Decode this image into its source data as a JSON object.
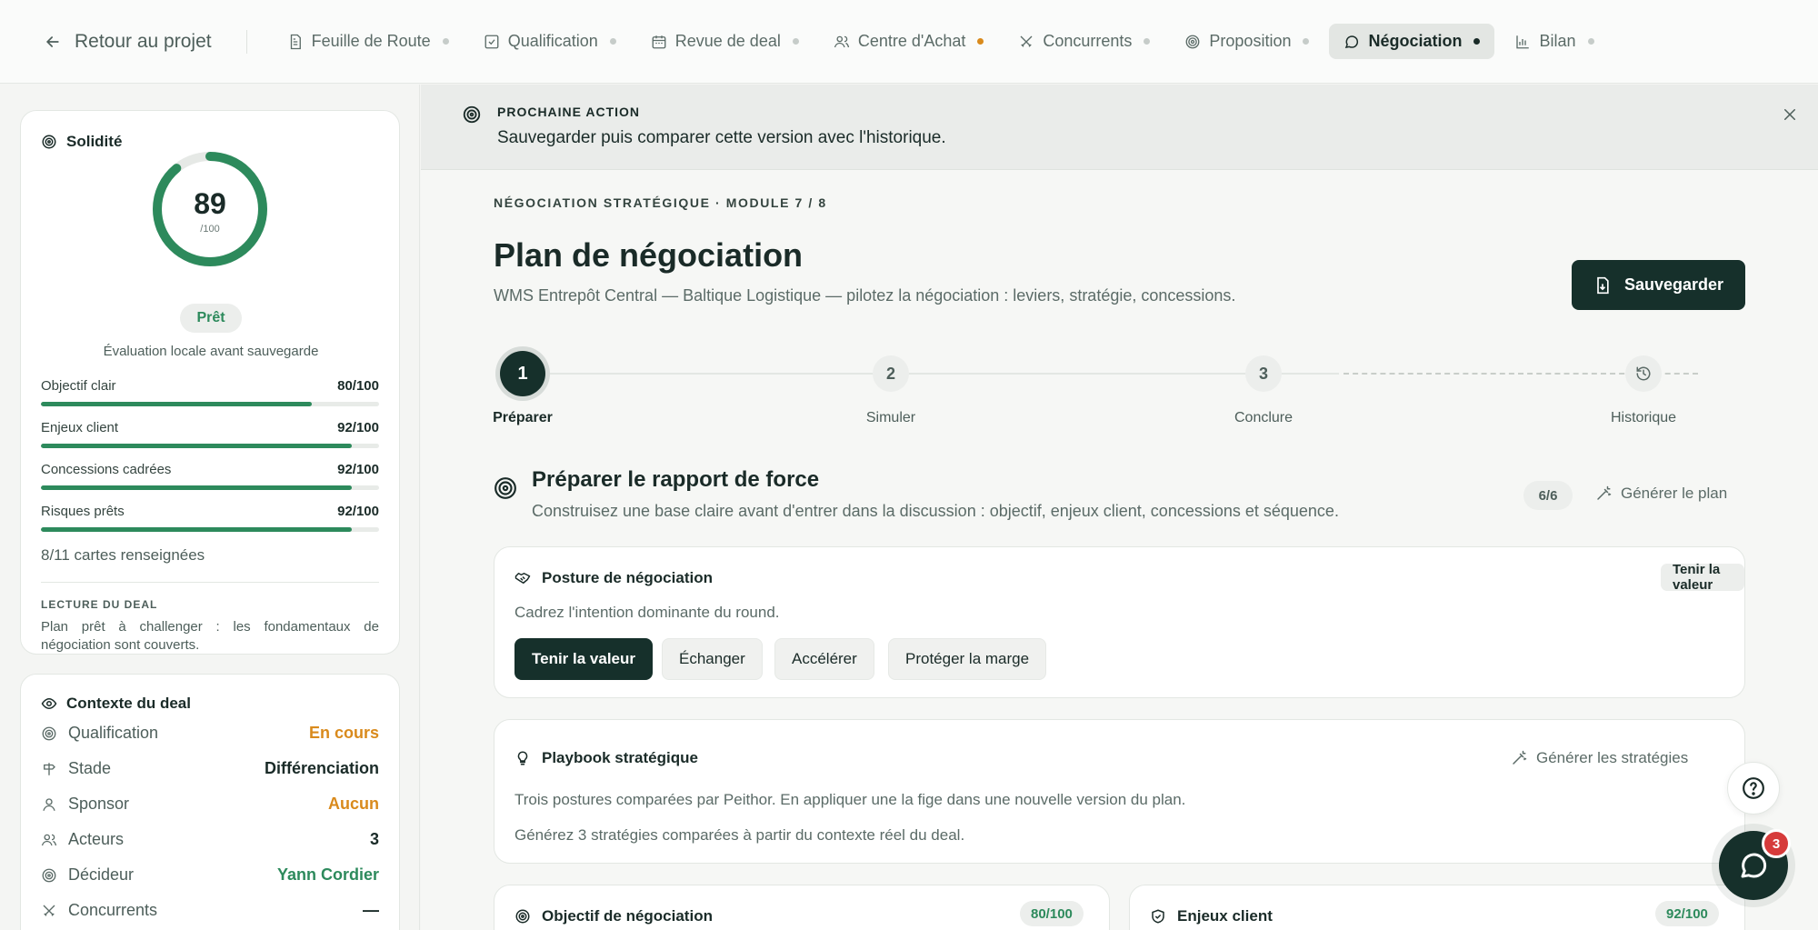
{
  "nav": {
    "back_label": "Retour au projet",
    "tabs": [
      {
        "label": "Feuille de Route",
        "icon": "file-text-icon",
        "dot": "grey"
      },
      {
        "label": "Qualification",
        "icon": "check-square-icon",
        "dot": "grey"
      },
      {
        "label": "Revue de deal",
        "icon": "calendar-icon",
        "dot": "grey"
      },
      {
        "label": "Centre d'Achat",
        "icon": "users-icon",
        "dot": "orange"
      },
      {
        "label": "Concurrents",
        "icon": "swords-icon",
        "dot": "grey"
      },
      {
        "label": "Proposition",
        "icon": "target-icon",
        "dot": "grey"
      },
      {
        "label": "Négociation",
        "icon": "chat-bubble-icon",
        "dot": "dark",
        "active": true
      },
      {
        "label": "Bilan",
        "icon": "bar-chart-icon",
        "dot": "grey"
      }
    ]
  },
  "sidebar": {
    "solidity": {
      "title": "Solidité",
      "score": 89,
      "score_max": "/100",
      "status": "Prêt",
      "note": "Évaluation locale avant sauvegarde",
      "metrics": [
        {
          "label": "Objectif clair",
          "value": "80/100",
          "pct": 80
        },
        {
          "label": "Enjeux client",
          "value": "92/100",
          "pct": 92
        },
        {
          "label": "Concessions cadrées",
          "value": "92/100",
          "pct": 92
        },
        {
          "label": "Risques prêts",
          "value": "92/100",
          "pct": 92
        }
      ],
      "cards_filled": "8/11 cartes renseignées",
      "reading_label": "LECTURE DU DEAL",
      "reading_text": "Plan prêt à challenger : les fondamentaux de négociation sont couverts."
    },
    "context": {
      "title": "Contexte du deal",
      "rows": [
        {
          "label": "Qualification",
          "value": "En cours",
          "color": "#d98a1c",
          "icon": "target-icon"
        },
        {
          "label": "Stade",
          "value": "Différenciation",
          "color": "#1a2b28",
          "icon": "signpost-icon"
        },
        {
          "label": "Sponsor",
          "value": "Aucun",
          "color": "#d98a1c",
          "icon": "user-icon"
        },
        {
          "label": "Acteurs",
          "value": "3",
          "color": "#1a2b28",
          "icon": "users-icon"
        },
        {
          "label": "Décideur",
          "value": "Yann Cordier",
          "color": "#2d8a5c",
          "icon": "target-icon"
        },
        {
          "label": "Concurrents",
          "value": "—",
          "color": "#1a2b28",
          "icon": "swords-icon"
        }
      ]
    }
  },
  "banner": {
    "label": "PROCHAINE ACTION",
    "text": "Sauvegarder puis comparer cette version avec l'historique."
  },
  "header": {
    "eyebrow": "NÉGOCIATION STRATÉGIQUE · MODULE 7 / 8",
    "title": "Plan de négociation",
    "subtitle": "WMS Entrepôt Central — Baltique Logistique — pilotez la négociation : leviers, stratégie, concessions.",
    "save_label": "Sauvegarder"
  },
  "steps": [
    {
      "num": "1",
      "label": "Préparer",
      "active": true
    },
    {
      "num": "2",
      "label": "Simuler"
    },
    {
      "num": "3",
      "label": "Conclure"
    },
    {
      "num": "",
      "label": "Historique",
      "icon": "history-icon"
    }
  ],
  "section": {
    "title": "Préparer le rapport de force",
    "subtitle": "Construisez une base claire avant d'entrer dans la discussion : objectif, enjeux client, concessions et séquence.",
    "count": "6/6",
    "generate_label": "Générer le plan"
  },
  "posture": {
    "title": "Posture de négociation",
    "tag": "Tenir la valeur",
    "desc": "Cadrez l'intention dominante du round.",
    "options": [
      "Tenir la valeur",
      "Échanger",
      "Accélérer",
      "Protéger la marge"
    ],
    "selected": 0
  },
  "playbook": {
    "title": "Playbook stratégique",
    "generate_label": "Générer les stratégies",
    "line1": "Trois postures comparées par Peithor. En appliquer une la fige dans une nouvelle version du plan.",
    "line2": "Générez 3 stratégies comparées à partir du contexte réel du deal."
  },
  "objective": {
    "title": "Objectif de négociation",
    "score": "80/100"
  },
  "client_stakes": {
    "title": "Enjeux client",
    "score": "92/100"
  },
  "chat": {
    "badge": "3"
  },
  "colors": {
    "accent": "#16302b",
    "success": "#2d8a5c",
    "warning": "#d98a1c",
    "danger": "#d63b3b"
  }
}
